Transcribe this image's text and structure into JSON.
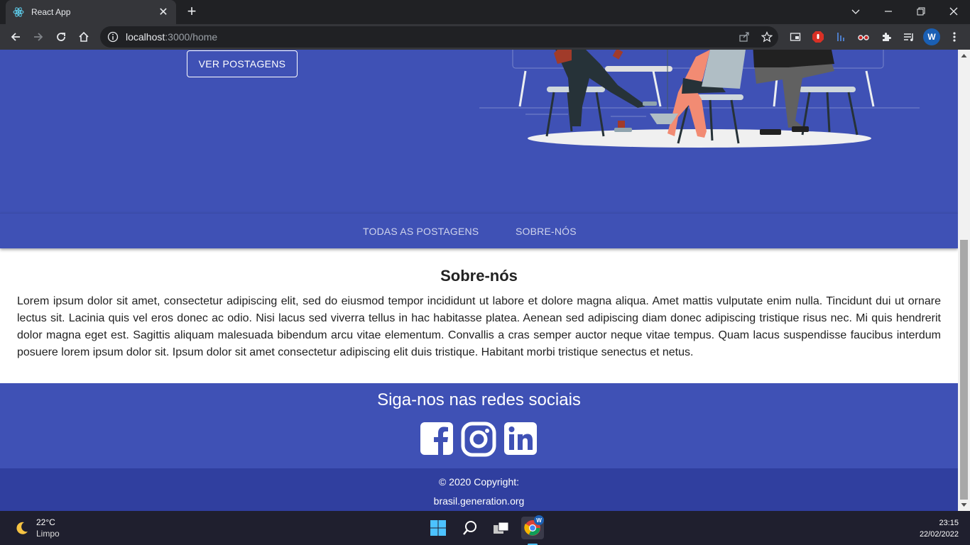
{
  "browser": {
    "tab_title": "React App",
    "url_host": "localhost",
    "url_path": ":3000/home",
    "profile_initial": "W"
  },
  "hero": {
    "button_label": "VER POSTAGENS"
  },
  "nav_tabs": [
    "TODAS AS POSTAGENS",
    "SOBRE-NÓS"
  ],
  "about": {
    "title": "Sobre-nós",
    "text": "Lorem ipsum dolor sit amet, consectetur adipiscing elit, sed do eiusmod tempor incididunt ut labore et dolore magna aliqua. Amet mattis vulputate enim nulla. Tincidunt dui ut ornare lectus sit. Lacinia quis vel eros donec ac odio. Nisi lacus sed viverra tellus in hac habitasse platea. Aenean sed adipiscing diam donec adipiscing tristique risus nec. Mi quis hendrerit dolor magna eget est. Sagittis aliquam malesuada bibendum arcu vitae elementum. Convallis a cras semper auctor neque vitae tempus. Quam lacus suspendisse faucibus interdum posuere lorem ipsum dolor sit. Ipsum dolor sit amet consectetur adipiscing elit duis tristique. Habitant morbi tristique senectus et netus."
  },
  "social": {
    "title": "Siga-nos nas redes sociais",
    "icons": [
      "facebook-icon",
      "instagram-icon",
      "linkedin-icon"
    ]
  },
  "footer": {
    "copyright": "© 2020 Copyright:",
    "site": "brasil.generation.org"
  },
  "taskbar": {
    "temperature": "22°C",
    "weather": "Limpo",
    "time": "23:15",
    "date": "22/02/2022"
  },
  "colors": {
    "primary": "#3f51b5",
    "primary_dark": "#303f9f",
    "chrome_dark": "#202124",
    "chrome_toolbar": "#35363a"
  }
}
